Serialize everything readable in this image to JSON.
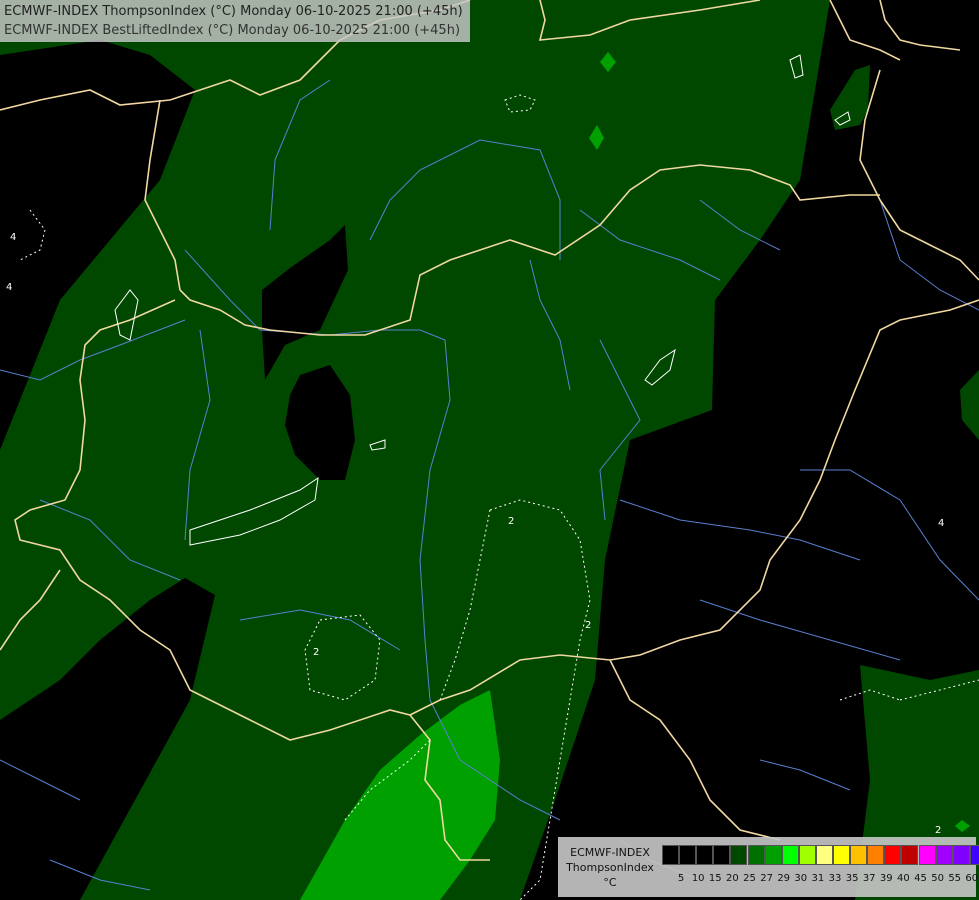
{
  "title": {
    "line1": "ECMWF-INDEX ThompsonIndex (°C) Monday 06-10-2025 21:00 (+45h)",
    "line2": "ECMWF-INDEX BestLiftedIndex (°C) Monday 06-10-2025 21:00 (+45h)"
  },
  "legend": {
    "title_line1": "ECMWF-INDEX",
    "title_line2": "ThompsonIndex",
    "title_line3": "°C",
    "colors": [
      "#000000",
      "#000000",
      "#000000",
      "#000000",
      "#004800",
      "#007000",
      "#00a000",
      "#00ff00",
      "#a0ff00",
      "#ffff80",
      "#ffff00",
      "#ffc000",
      "#ff8000",
      "#ff0000",
      "#c00000",
      "#ff00ff",
      "#a000ff",
      "#8000ff",
      "#4000ff",
      "#0000ff"
    ],
    "labels": [
      "5",
      "10",
      "15",
      "20",
      "25",
      "27",
      "29",
      "30",
      "31",
      "33",
      "35",
      "37",
      "39",
      "40",
      "45",
      "50",
      "55",
      "60"
    ]
  },
  "contour_labels": [
    "4",
    "4",
    "4",
    "2",
    "2",
    "2",
    "2"
  ],
  "map_colors": {
    "background": "#000000",
    "dark_green": "#004800",
    "green": "#007000",
    "bright_green": "#00a000",
    "border": "#f0d8a0",
    "river": "#5a7fd0",
    "contour": "#ffffff"
  }
}
